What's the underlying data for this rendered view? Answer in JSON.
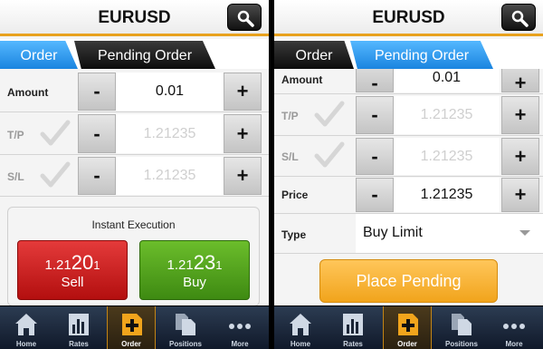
{
  "colors": {
    "accent": "#e8a21e",
    "tab_active": "#1a84e0",
    "sell": "#c21b1b",
    "buy": "#4f9e1c",
    "place": "#f1a41c"
  },
  "left": {
    "header": {
      "title": "EURUSD",
      "search_icon": "search-icon"
    },
    "tabs": [
      {
        "label": "Order",
        "active": true
      },
      {
        "label": "Pending Order",
        "active": false
      }
    ],
    "rows": [
      {
        "label": "Amount",
        "value": "0.01",
        "minus": "-",
        "plus": "+"
      },
      {
        "label": "T/P",
        "value": "1.21235",
        "minus": "-",
        "plus": "+",
        "checked": false
      },
      {
        "label": "S/L",
        "value": "1.21235",
        "minus": "-",
        "plus": "+",
        "checked": false
      }
    ],
    "execution": {
      "title": "Instant Execution",
      "sell": {
        "prefix": "1.21",
        "big": "20",
        "small": "1",
        "label": "Sell"
      },
      "buy": {
        "prefix": "1.21",
        "big": "23",
        "small": "1",
        "label": "Buy"
      }
    }
  },
  "right": {
    "header": {
      "title": "EURUSD",
      "search_icon": "search-icon"
    },
    "tabs": [
      {
        "label": "Order",
        "active": false
      },
      {
        "label": "Pending Order",
        "active": true
      }
    ],
    "rows": [
      {
        "label": "Amount",
        "value": "0.01",
        "minus": "-",
        "plus": "+"
      },
      {
        "label": "T/P",
        "value": "1.21235",
        "minus": "-",
        "plus": "+",
        "checked": false
      },
      {
        "label": "S/L",
        "value": "1.21235",
        "minus": "-",
        "plus": "+",
        "checked": false
      },
      {
        "label": "Price",
        "value": "1.21235",
        "minus": "-",
        "plus": "+"
      }
    ],
    "type": {
      "label": "Type",
      "value": "Buy Limit"
    },
    "place_button": "Place Pending"
  },
  "nav": [
    {
      "label": "Home",
      "icon": "home-icon"
    },
    {
      "label": "Rates",
      "icon": "rates-icon"
    },
    {
      "label": "Order",
      "icon": "order-icon",
      "active": true
    },
    {
      "label": "Positions",
      "icon": "positions-icon"
    },
    {
      "label": "More",
      "icon": "more-icon"
    }
  ]
}
